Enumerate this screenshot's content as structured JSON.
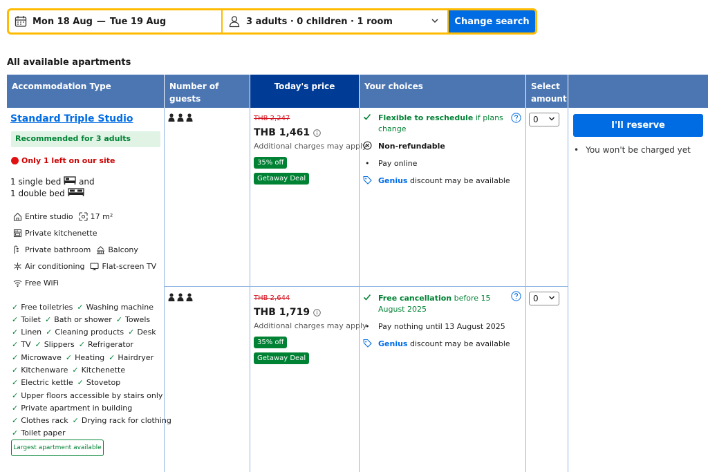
{
  "search": {
    "date_from": "Mon 18 Aug",
    "date_sep": "—",
    "date_to": "Tue 19 Aug",
    "guests": "3 adults · 0 children · 1 room",
    "button": "Change search"
  },
  "section_title": "All available apartments",
  "table": {
    "headers": {
      "type": "Accommodation Type",
      "guests": "Number of guests",
      "price": "Today's price",
      "choices": "Your choices",
      "amount": "Select amount"
    }
  },
  "room": {
    "name": "Standard Triple Studio",
    "recommended": "Recommended for 3 adults",
    "urgency": "Only 1 left on our site",
    "bed1": "1 single bed",
    "bed_and": "and",
    "bed2": "1 double bed",
    "facilities": {
      "entire": "Entire studio",
      "size": "17 m²",
      "kitchenette": "Private kitchenette",
      "bathroom": "Private bathroom",
      "balcony": "Balcony",
      "ac": "Air conditioning",
      "tv": "Flat-screen TV",
      "wifi": "Free WiFi"
    },
    "amenities": [
      [
        "Free toiletries",
        "Washing machine"
      ],
      [
        "Toilet",
        "Bath or shower",
        "Towels"
      ],
      [
        "Linen",
        "Cleaning products",
        "Desk"
      ],
      [
        "TV",
        "Slippers",
        "Refrigerator"
      ],
      [
        "Microwave",
        "Heating",
        "Hairdryer"
      ],
      [
        "Kitchenware",
        "Kitchenette"
      ],
      [
        "Electric kettle",
        "Stovetop"
      ],
      [
        "Upper floors accessible by stairs only"
      ],
      [
        "Private apartment in building"
      ],
      [
        "Clothes rack",
        "Drying rack for clothing"
      ],
      [
        "Toilet paper"
      ]
    ],
    "largest": "Largest apartment available"
  },
  "options": [
    {
      "old_price": "THB 2,247",
      "price": "THB 1,461",
      "charges": "Additional charges may apply",
      "discount": "35% off",
      "deal": "Getaway Deal",
      "choice1_bold": "Flexible to reschedule",
      "choice1_rest": "if plans change",
      "choice2": "Non-refundable",
      "choice3": "Pay online",
      "genius": "Genius",
      "genius_rest": "discount may be available",
      "amount": "0"
    },
    {
      "old_price": "THB 2,644",
      "price": "THB 1,719",
      "charges": "Additional charges may apply",
      "discount": "35% off",
      "deal": "Getaway Deal",
      "choice1_bold": "Free cancellation",
      "choice1_rest": "before 15 August 2025",
      "choice3": "Pay nothing until 13 August 2025",
      "genius": "Genius",
      "genius_rest": "discount may be available",
      "amount": "0"
    }
  ],
  "reserve": {
    "button": "I'll reserve",
    "note": "You won't be charged yet"
  },
  "colors": {
    "brand_blue": "#006ce4",
    "header_blue": "#4c76b2",
    "header_dark": "#003b95",
    "green": "#008234",
    "yellow": "#febb02",
    "red": "#d4111e"
  }
}
